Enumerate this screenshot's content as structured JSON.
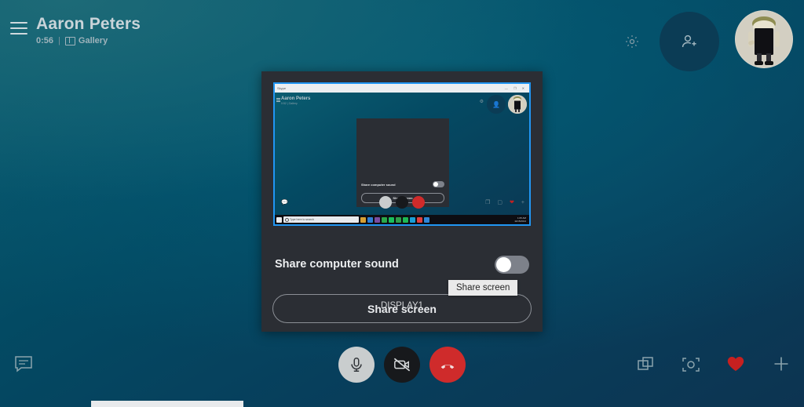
{
  "theme": {
    "bg_teal": "#0b5d70",
    "bg_navy": "#0d3451",
    "dialog_bg": "#2b2e34",
    "accent_blue": "#2196f3",
    "end_call_red": "#cf2b2b",
    "heart_red": "#c62020",
    "toggle_track": "#7d818a",
    "tooltip_bg": "#eaeaea"
  },
  "header": {
    "menu_icon": "hamburger-icon",
    "title": "Aaron Peters",
    "duration": "0:56",
    "separator": "|",
    "view_mode": "Gallery",
    "view_mode_icon": "gallery-grid-icon",
    "settings_icon": "gear-icon",
    "invite_icon": "add-person-icon",
    "avatar_icon": "user-avatar"
  },
  "share_dialog": {
    "display_label": "DISPLAY1",
    "sound_label": "Share computer sound",
    "sound_toggle_state": "off",
    "share_button_label": "Share screen",
    "tooltip_text": "Share screen",
    "thumbnail": {
      "window_title": "Skype",
      "window_controls": "—  ❐  ✕",
      "nested_call_title": "Aaron Peters",
      "nested_subtitle": "0:52  |  Gallery",
      "nested_sound_label": "Share computer sound",
      "nested_share_button": "Share screen",
      "taskbar_search_placeholder": "Type here to search",
      "taskbar_clock_time": "1:05 AM",
      "taskbar_clock_date": "11/15/2014",
      "taskbar_icons": [
        "#d6a034",
        "#2e7fd6",
        "#7a4ca0",
        "#2aa84a",
        "#19c05c",
        "#2f9f4a",
        "#1db954",
        "#1a9fd6",
        "#e04040",
        "#2f86d6"
      ]
    }
  },
  "controls": {
    "chat_icon": "chat-bubble-icon",
    "mic_icon": "microphone-icon",
    "mic_state": "on",
    "camera_icon": "camera-off-icon",
    "camera_state": "off",
    "end_call_icon": "end-call-icon",
    "screenshare_icon": "screen-share-icon",
    "snapshot_icon": "snapshot-camera-icon",
    "reaction_icon": "heart-icon",
    "add_icon": "plus-icon"
  }
}
